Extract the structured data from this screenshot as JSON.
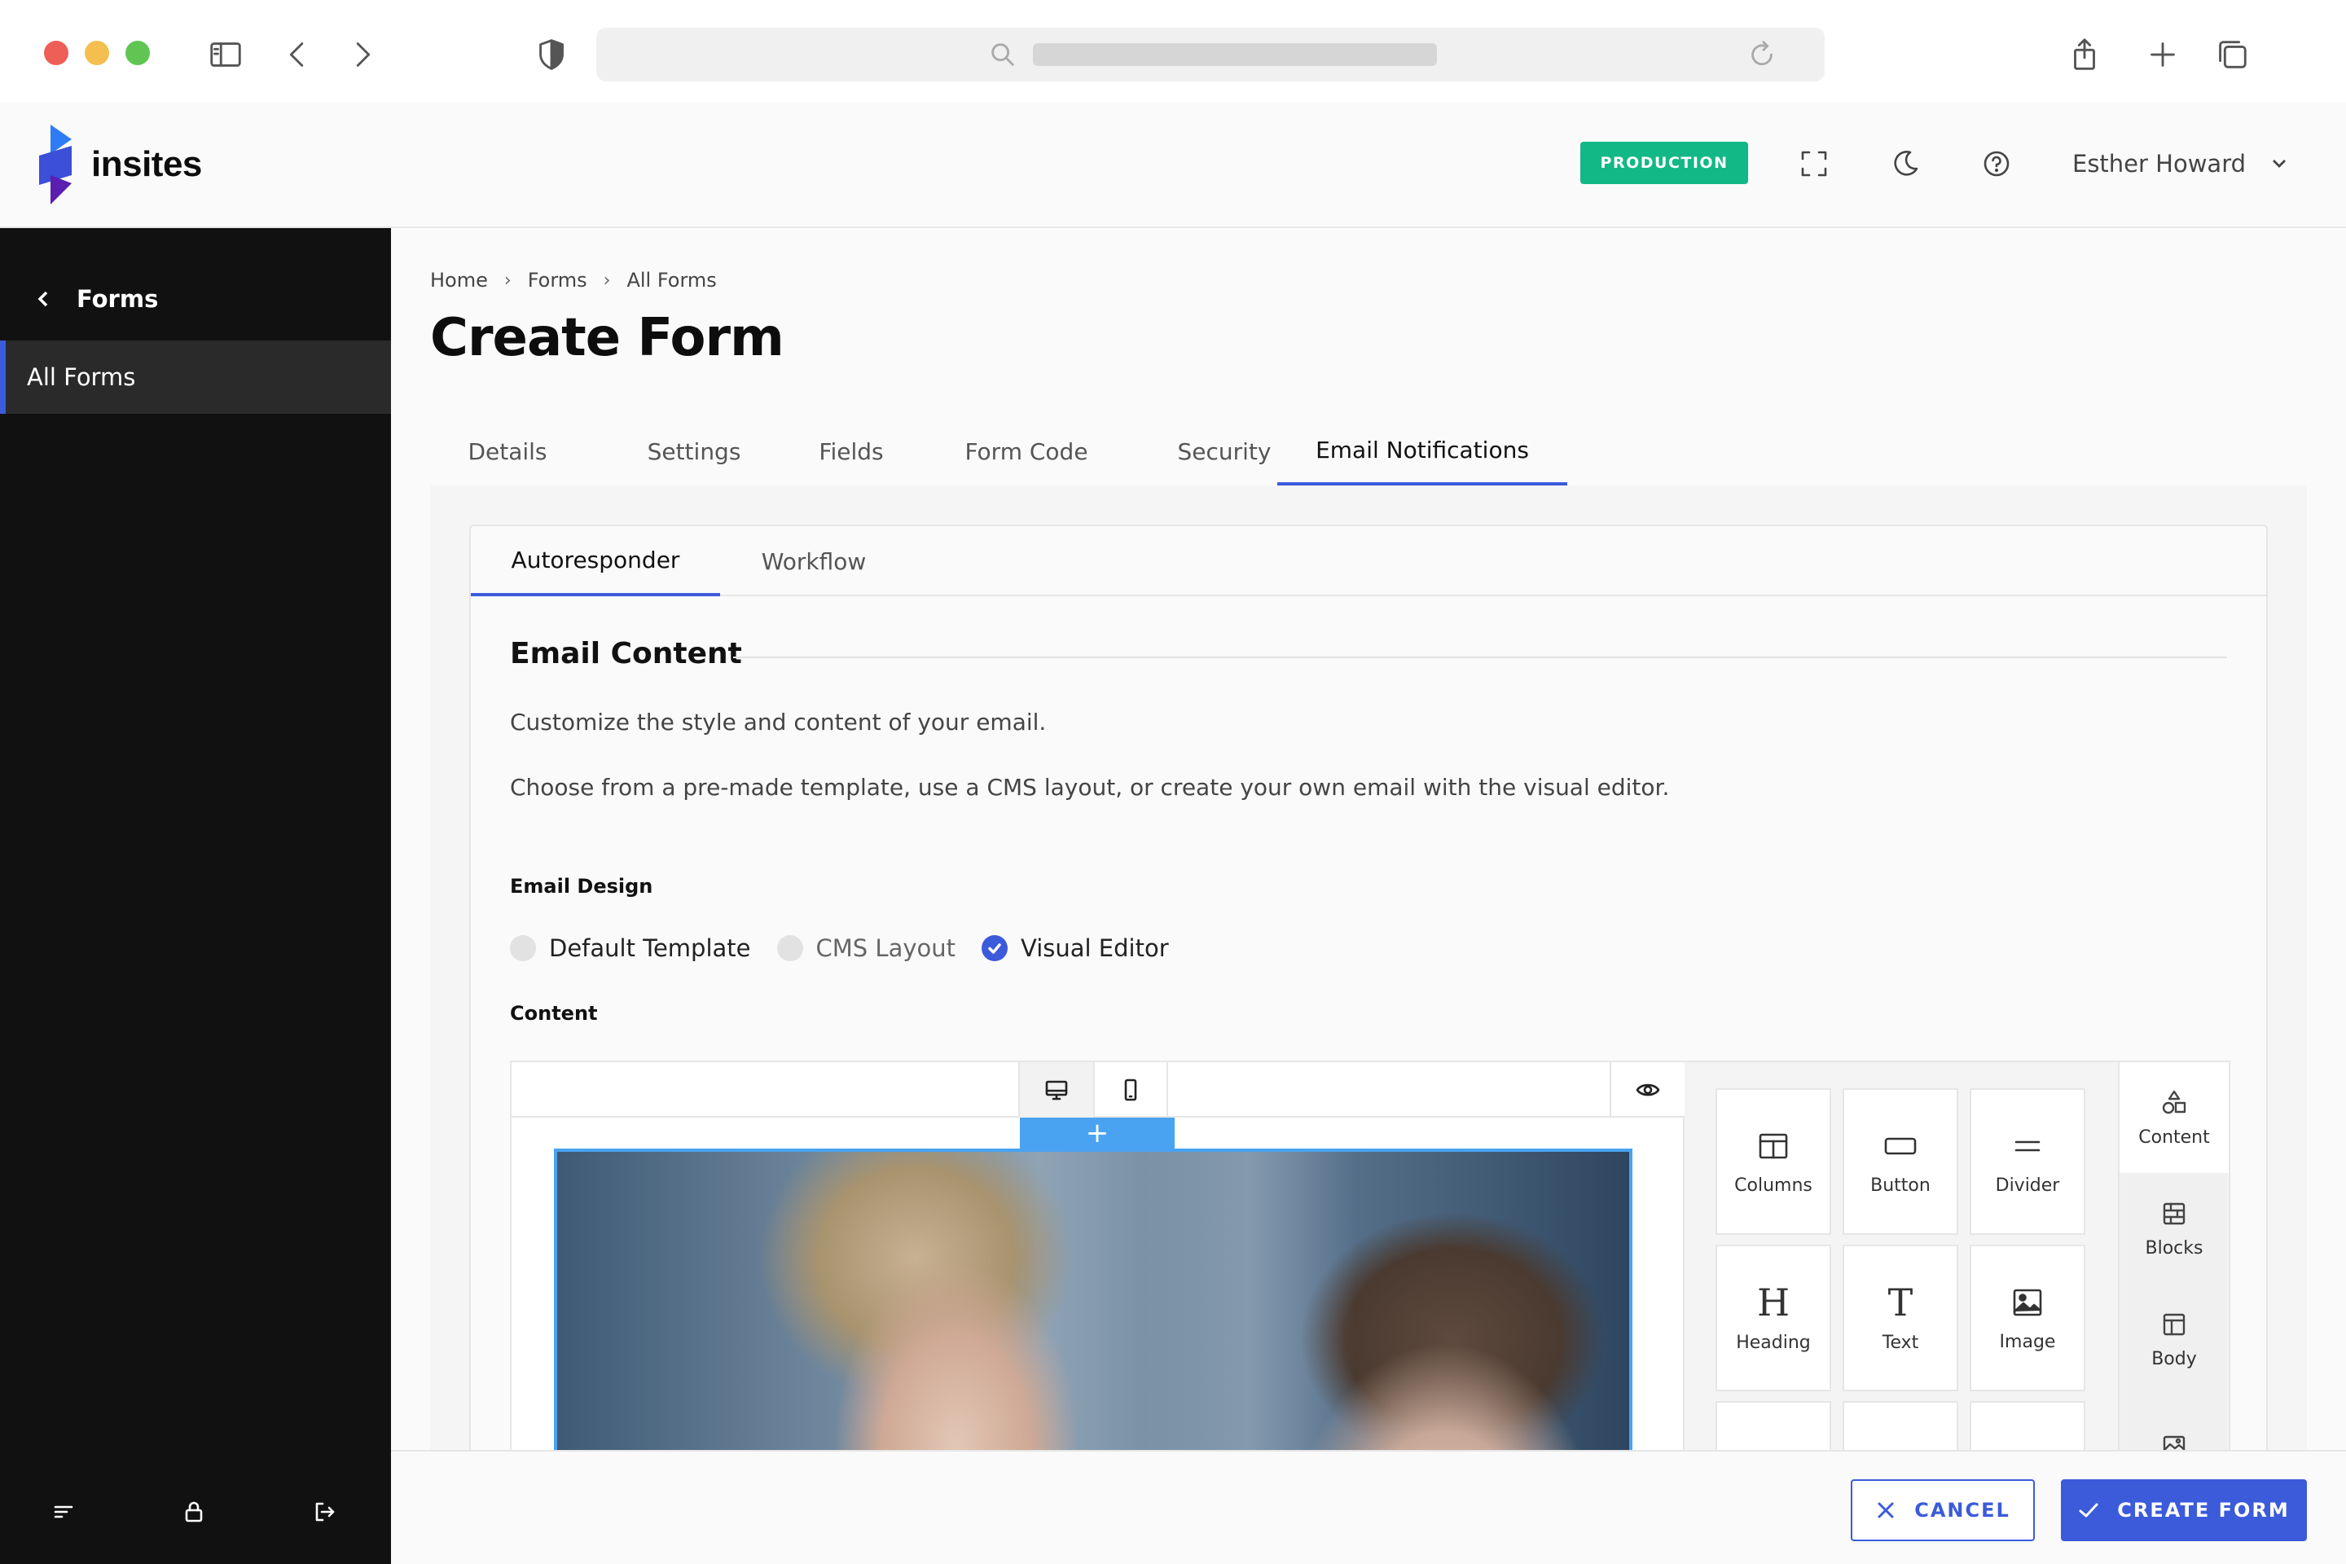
{
  "app": {
    "name": "insites"
  },
  "header": {
    "environment": "PRODUCTION",
    "user_name": "Esther Howard"
  },
  "sidebar": {
    "back_label": "Forms",
    "items": [
      {
        "label": "All Forms",
        "active": true
      }
    ]
  },
  "breadcrumb": [
    "Home",
    "Forms",
    "All Forms"
  ],
  "page_title": "Create Form",
  "tabs": [
    {
      "label": "Details"
    },
    {
      "label": "Settings"
    },
    {
      "label": "Fields"
    },
    {
      "label": "Form Code"
    },
    {
      "label": "Security"
    },
    {
      "label": "Email Notifications",
      "active": true
    }
  ],
  "subtabs": [
    {
      "label": "Autoresponder",
      "active": true
    },
    {
      "label": "Workflow"
    }
  ],
  "email_content": {
    "title": "Email Content",
    "desc1": "Customize the style and content of your email.",
    "desc2": "Choose from a pre-made template, use a CMS layout, or create your own email with the visual editor.",
    "design_label": "Email Design",
    "options": [
      {
        "label": "Default Template",
        "checked": false
      },
      {
        "label": "CMS Layout",
        "checked": false
      },
      {
        "label": "Visual Editor",
        "checked": true
      }
    ],
    "content_label": "Content"
  },
  "editor": {
    "add_symbol": "+",
    "tools": [
      "Columns",
      "Button",
      "Divider",
      "Heading",
      "Text",
      "Image"
    ],
    "tool_glyphs": {
      "heading": "H",
      "text": "T"
    },
    "rail": [
      "Content",
      "Blocks",
      "Body"
    ]
  },
  "footer": {
    "cancel_label": "CANCEL",
    "create_label": "CREATE FORM"
  },
  "colors": {
    "accent": "#3b5bdb",
    "production": "#12b886",
    "editor_highlight": "#4aa3f0",
    "sidebar_bg": "#111111"
  }
}
